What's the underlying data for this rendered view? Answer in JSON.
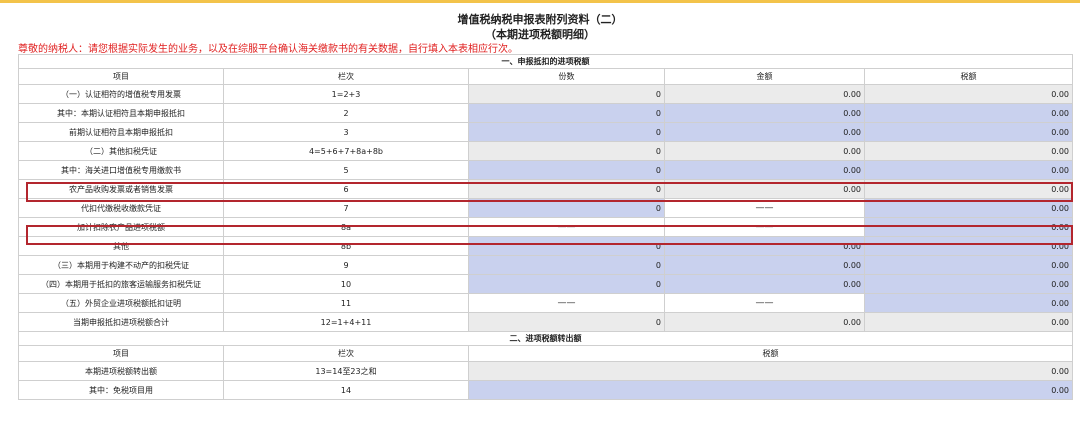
{
  "page": {
    "title": "增值税纳税申报表附列资料（二）",
    "subtitle": "（本期进项税额明细）",
    "notice": "尊敬的纳税人：请您根据实际发生的业务，以及在综服平台确认海关缴款书的有关数据，自行填入本表相应行次。"
  },
  "section1": {
    "title": "一、申报抵扣的进项税额",
    "headers": {
      "item": "项目",
      "line": "栏次",
      "count": "份数",
      "amount": "金额",
      "tax": "税额"
    },
    "rows": [
      {
        "item": "（一）认证相符的增值税专用发票",
        "line": "1=2+3",
        "count": "0",
        "amount": "0.00",
        "tax": "0.00"
      },
      {
        "item": "其中：本期认证相符且本期申报抵扣",
        "line": "2",
        "count": "0",
        "amount": "0.00",
        "tax": "0.00"
      },
      {
        "item": "前期认证相符且本期申报抵扣",
        "line": "3",
        "count": "0",
        "amount": "0.00",
        "tax": "0.00"
      },
      {
        "item": "（二）其他扣税凭证",
        "line": "4=5+6+7+8a+8b",
        "count": "0",
        "amount": "0.00",
        "tax": "0.00"
      },
      {
        "item": "其中：海关进口增值税专用缴款书",
        "line": "5",
        "count": "0",
        "amount": "0.00",
        "tax": "0.00"
      },
      {
        "item": "农产品收购发票或者销售发票",
        "line": "6",
        "count": "0",
        "amount": "0.00",
        "tax": "0.00"
      },
      {
        "item": "代扣代缴税收缴款凭证",
        "line": "7",
        "count": "0",
        "amount": "——",
        "tax": "0.00"
      },
      {
        "item": "加计扣除农产品进项税额",
        "line": "8a",
        "count": "——",
        "amount": "——",
        "tax": "0.00"
      },
      {
        "item": "其他",
        "line": "8b",
        "count": "0",
        "amount": "0.00",
        "tax": "0.00"
      },
      {
        "item": "（三）本期用于构建不动产的扣税凭证",
        "line": "9",
        "count": "0",
        "amount": "0.00",
        "tax": "0.00"
      },
      {
        "item": "（四）本期用于抵扣的旅客运输服务扣税凭证",
        "line": "10",
        "count": "0",
        "amount": "0.00",
        "tax": "0.00"
      },
      {
        "item": "（五）外贸企业进项税额抵扣证明",
        "line": "11",
        "count": "——",
        "amount": "——",
        "tax": "0.00"
      },
      {
        "item": "当期申报抵扣进项税额合计",
        "line": "12=1+4+11",
        "count": "0",
        "amount": "0.00",
        "tax": "0.00"
      }
    ]
  },
  "section2": {
    "title": "二、进项税额转出额",
    "headers": {
      "item": "项目",
      "line": "栏次",
      "tax": "税额"
    },
    "rows": [
      {
        "item": "本期进项税额转出额",
        "line": "13=14至23之和",
        "tax": "0.00"
      },
      {
        "item": "其中：免税项目用",
        "line": "14",
        "tax": "0.00"
      }
    ]
  },
  "colors": {
    "highlight": "#b3262e",
    "gray_cell": "#ebebeb",
    "blue_cell": "#c9d1ee",
    "notice": "#e02020"
  }
}
